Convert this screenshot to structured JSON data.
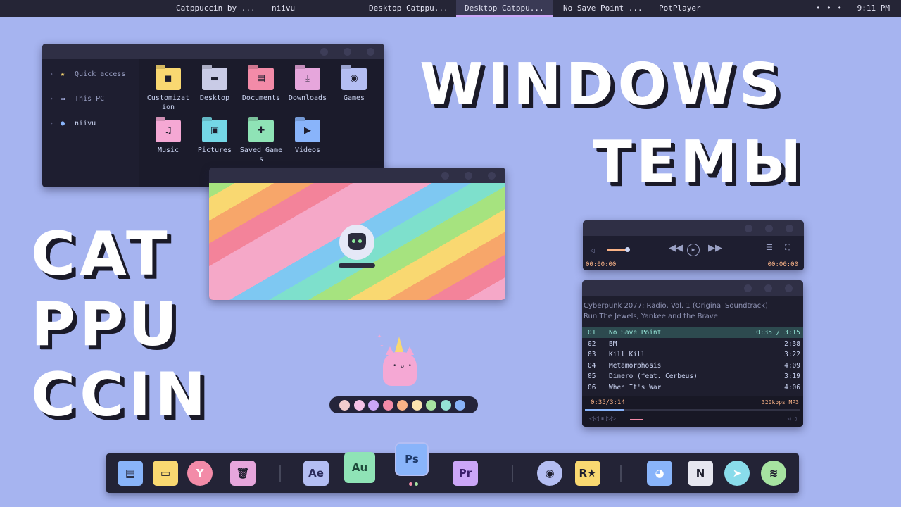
{
  "taskbar": {
    "tasks": [
      {
        "label": "Catppuccin by ...",
        "active": false
      },
      {
        "label": "niivu",
        "active": false
      },
      {
        "label": "Desktop Catppu...",
        "active": false
      },
      {
        "label": "Desktop Catppu...",
        "active": true
      },
      {
        "label": "No Save Point ...",
        "active": false
      },
      {
        "label": "PotPlayer",
        "active": false
      }
    ],
    "tray_dots": "• • •",
    "clock": "9:11 PM"
  },
  "explorer": {
    "sidebar": [
      {
        "label": "Quick access",
        "icon": "star-icon"
      },
      {
        "label": "This PC",
        "icon": "monitor-icon"
      },
      {
        "label": "niivu",
        "icon": "user-icon"
      }
    ],
    "folders": [
      {
        "label": "Customization",
        "color": "#f9d871",
        "glyph": "◼"
      },
      {
        "label": "Desktop",
        "color": "#c9cbe6",
        "glyph": "▬"
      },
      {
        "label": "Documents",
        "color": "#f38ba8",
        "glyph": "▤"
      },
      {
        "label": "Downloads",
        "color": "#e6a6dc",
        "glyph": "⤓"
      },
      {
        "label": "Games",
        "color": "#b4bef3",
        "glyph": "◉"
      },
      {
        "label": "Music",
        "color": "#f5a8d4",
        "glyph": "♫"
      },
      {
        "label": "Pictures",
        "color": "#74d7e6",
        "glyph": "▣"
      },
      {
        "label": "Saved Games",
        "color": "#8fe3b6",
        "glyph": "✚"
      },
      {
        "label": "Videos",
        "color": "#89b4fa",
        "glyph": "▶"
      }
    ]
  },
  "headline": {
    "line1": "WINDOWS",
    "line2": "ТЕМЫ",
    "line3": "CAT",
    "line4": "PPU",
    "line5": "CCIN"
  },
  "mini_player": {
    "time_left": "00:00:00",
    "time_right": "00:00:00",
    "volume_level": 0.8
  },
  "playlist_player": {
    "album": "Cyberpunk 2077: Radio, Vol. 1 (Original Soundtrack)",
    "artist": "Run The Jewels, Yankee and the Brave",
    "tracks": [
      {
        "num": "01",
        "title": "No Save Point",
        "duration": "0:35 / 3:15",
        "current": true
      },
      {
        "num": "02",
        "title": "BM",
        "duration": "2:38",
        "current": false
      },
      {
        "num": "03",
        "title": "Kill Kill",
        "duration": "3:22",
        "current": false
      },
      {
        "num": "04",
        "title": "Metamorphosis",
        "duration": "4:09",
        "current": false
      },
      {
        "num": "05",
        "title": "Dinero (feat. Cerbeus)",
        "duration": "3:19",
        "current": false
      },
      {
        "num": "06",
        "title": "When It's War",
        "duration": "4:06",
        "current": false
      }
    ],
    "position": "0:35/3:14",
    "bitrate": "320kbps MP3",
    "progress": 0.18
  },
  "palette": {
    "colors": [
      "#f2cdcd",
      "#f5c2e7",
      "#cba6f7",
      "#f38ba8",
      "#fab387",
      "#f9e2af",
      "#a6e3a1",
      "#94e2d5",
      "#89b4fa"
    ]
  },
  "dock": {
    "items": [
      {
        "name": "files-app-icon",
        "glyph": "▤",
        "bg": "#89b4fa",
        "fg": "#1e1e2e"
      },
      {
        "name": "folder-app-icon",
        "glyph": "▭",
        "bg": "#f9d871",
        "fg": "#1e1e2e"
      },
      {
        "name": "yandex-browser-icon",
        "glyph": "Y",
        "bg": "#f38ba8",
        "fg": "#ffffff"
      },
      {
        "name": "recycle-bin-icon",
        "glyph": "🗑",
        "bg": "#e6a6dc",
        "fg": "#1e1e2e"
      },
      {
        "name": "after-effects-icon",
        "glyph": "Ae",
        "bg": "#b4bef3",
        "fg": "#2a2a5a"
      },
      {
        "name": "audition-icon",
        "glyph": "Au",
        "bg": "#8fe3b6",
        "fg": "#1e4a3a"
      },
      {
        "name": "photoshop-icon",
        "glyph": "Ps",
        "bg": "#89b4fa",
        "fg": "#1e3a6a"
      },
      {
        "name": "premiere-icon",
        "glyph": "Pr",
        "bg": "#cba6f7",
        "fg": "#3a1e6a"
      },
      {
        "name": "steam-icon",
        "glyph": "◉",
        "bg": "#b4bef3",
        "fg": "#1e1e2e"
      },
      {
        "name": "rockstar-icon",
        "glyph": "R★",
        "bg": "#f9d871",
        "fg": "#1e1e2e"
      },
      {
        "name": "discord-icon",
        "glyph": "◕",
        "bg": "#89b4fa",
        "fg": "#ffffff"
      },
      {
        "name": "notion-icon",
        "glyph": "N",
        "bg": "#e6e6f0",
        "fg": "#1e1e2e"
      },
      {
        "name": "telegram-icon",
        "glyph": "➤",
        "bg": "#89dceb",
        "fg": "#ffffff"
      },
      {
        "name": "spotify-icon",
        "glyph": "≋",
        "bg": "#a6e3a1",
        "fg": "#1e1e2e"
      }
    ]
  }
}
